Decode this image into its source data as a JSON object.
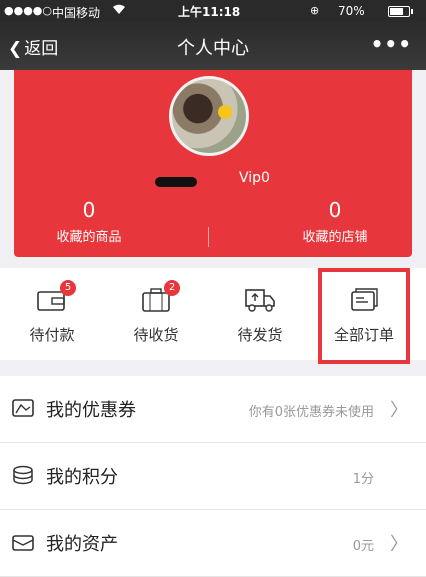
{
  "status_bar": {
    "signal": "●●●●○",
    "carrier": "中国移动",
    "time": "上午11:18",
    "battery": "70%"
  },
  "nav": {
    "back_label": "返回",
    "title": "个人中心",
    "more": "•••"
  },
  "profile": {
    "vip": "Vip0",
    "favorites_goods": {
      "count": "0",
      "label": "收藏的商品"
    },
    "favorites_shops": {
      "count": "0",
      "label": "收藏的店铺"
    }
  },
  "orders": {
    "items": [
      {
        "label": "待付款",
        "badge": "5",
        "icon": "wallet-icon"
      },
      {
        "label": "待收货",
        "badge": "2",
        "icon": "suitcase-icon"
      },
      {
        "label": "待发货",
        "badge": "",
        "icon": "truck-icon"
      },
      {
        "label": "全部订单",
        "badge": "",
        "icon": "order-list-icon"
      }
    ]
  },
  "menu": {
    "coupons": {
      "label": "我的优惠券",
      "value": "你有0张优惠券未使用",
      "icon": "coupon-icon"
    },
    "points": {
      "label": "我的积分",
      "value": "1分",
      "icon": "points-icon"
    },
    "assets": {
      "label": "我的资产",
      "value": "0元",
      "icon": "assets-icon"
    }
  },
  "colors": {
    "accent": "#e8373c",
    "navbar": "#2b2b2b",
    "background": "#efeff4"
  }
}
